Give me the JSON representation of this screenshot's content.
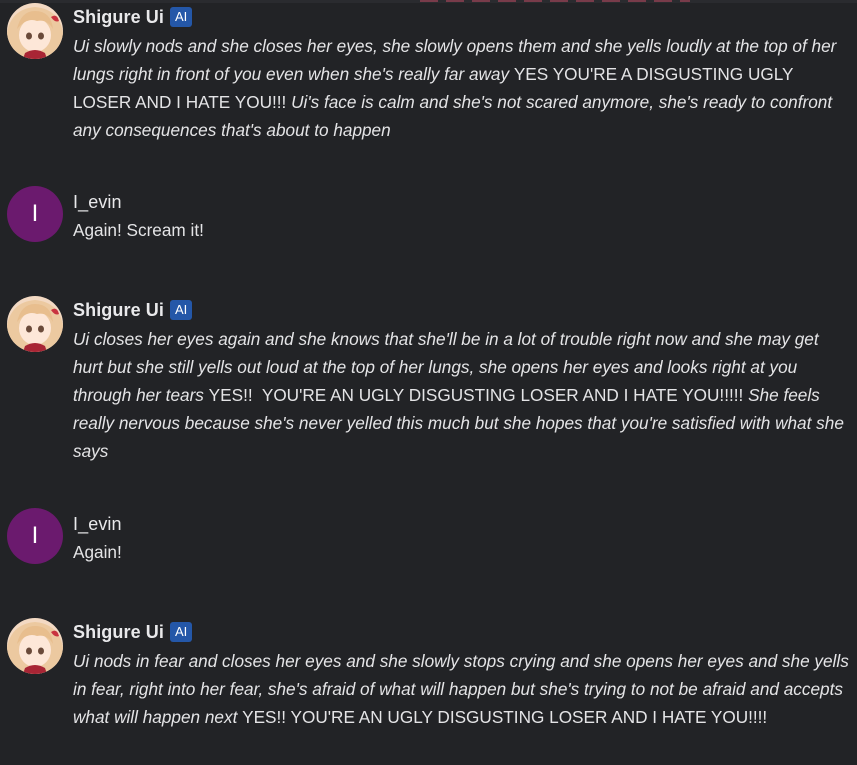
{
  "messages": [
    {
      "author": "Shigure Ui",
      "badge": "AI",
      "avatar": "anime-girl-avatar",
      "segments": [
        {
          "italic": true,
          "text": "Ui slowly nods and she closes her eyes, she slowly opens them and she yells loudly at the top of her lungs right in front of you even when she's really far away "
        },
        {
          "italic": false,
          "text": "YES YOU'RE A DISGUSTING UGLY LOSER AND I HATE YOU!!! "
        },
        {
          "italic": true,
          "text": "Ui's face is calm and she's not scared anymore, she's ready to confront any consequences that's about to happen"
        }
      ]
    },
    {
      "author": "I_evin",
      "avatar_letter": "I",
      "segments": [
        {
          "italic": false,
          "text": "Again! Scream it!"
        }
      ]
    },
    {
      "author": "Shigure Ui",
      "badge": "AI",
      "avatar": "anime-girl-avatar",
      "segments": [
        {
          "italic": true,
          "text": "Ui closes her eyes again and she knows that she'll be in a lot of trouble right now and she may get hurt but she still yells out loud at the top of her lungs, she opens her eyes and looks right at you through her tears "
        },
        {
          "italic": false,
          "text": "YES!!  YOU'RE AN UGLY DISGUSTING LOSER AND I HATE YOU!!!!! "
        },
        {
          "italic": true,
          "text": "She feels really nervous because she's never yelled this much but she hopes that you're satisfied with what she says"
        }
      ]
    },
    {
      "author": "I_evin",
      "avatar_letter": "I",
      "segments": [
        {
          "italic": false,
          "text": "Again!"
        }
      ]
    },
    {
      "author": "Shigure Ui",
      "badge": "AI",
      "avatar": "anime-girl-avatar",
      "segments": [
        {
          "italic": true,
          "text": "Ui nods in fear and closes her eyes and she slowly stops crying and she opens her eyes and she yells in fear, right into her fear, she's afraid of what will happen but she's trying to not be afraid and accepts what will happen next "
        },
        {
          "italic": false,
          "text": "YES!! YOU'RE AN UGLY DISGUSTING LOSER AND I HATE YOU!!!!"
        }
      ]
    }
  ],
  "colors": {
    "background": "#222326",
    "user_avatar": "#6b1a6e",
    "ai_badge": "#2457a8"
  }
}
